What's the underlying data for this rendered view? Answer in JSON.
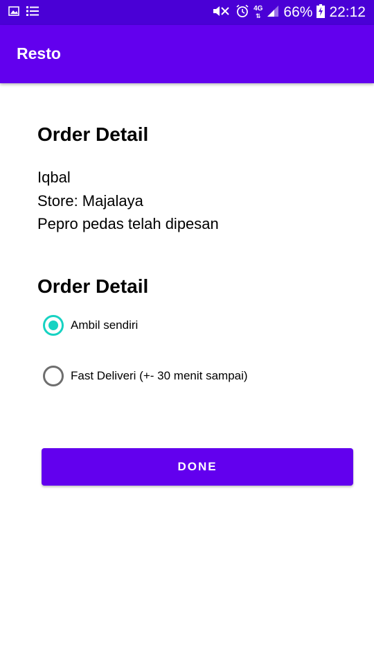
{
  "status_bar": {
    "battery_percent": "66%",
    "time": "22:12",
    "network_label": "4G",
    "icons": [
      "image-icon",
      "list-icon",
      "mute-icon",
      "alarm-icon",
      "network-icon",
      "signal-icon",
      "battery-icon"
    ]
  },
  "app_bar": {
    "title": "Resto"
  },
  "order_section": {
    "heading": "Order Detail",
    "customer_name": "Iqbal",
    "store": "Store: Majalaya",
    "message": "Pepro pedas telah dipesan"
  },
  "delivery_section": {
    "heading": "Order Detail",
    "options": [
      {
        "label": "Ambil sendiri",
        "checked": true
      },
      {
        "label": "Fast Deliveri (+- 30 menit sampai)",
        "checked": false
      }
    ]
  },
  "done_button": {
    "label": "DONE"
  },
  "colors": {
    "status_bar": "#4a00d6",
    "primary": "#6200ee",
    "radio_checked": "#17d2c2",
    "radio_unchecked": "#6e6e6e"
  }
}
